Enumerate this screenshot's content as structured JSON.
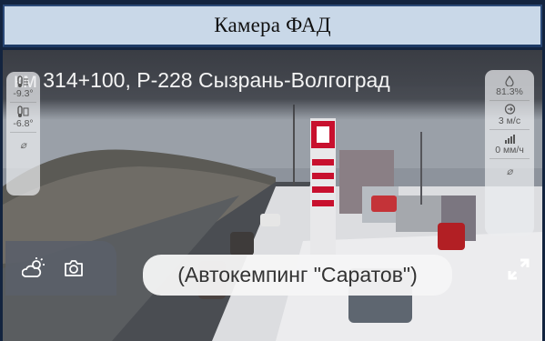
{
  "window": {
    "title": "Камера ФАД"
  },
  "camera": {
    "caption": "км 314+100, Р-228 Сызрань-Волгоград",
    "location": "(Автокемпинг \"Саратов\")"
  },
  "sensors_left": [
    {
      "icon": "road-temperature-icon",
      "value": "-9.3°"
    },
    {
      "icon": "air-temperature-icon",
      "value": "-6.8°"
    }
  ],
  "sensors_right": [
    {
      "icon": "humidity-icon",
      "value": "81.3%"
    },
    {
      "icon": "wind-icon",
      "value": "3 м/с"
    },
    {
      "icon": "precipitation-icon",
      "value": "0 мм/ч"
    }
  ],
  "controls": {
    "weather_icon": "weather-icon",
    "snapshot_icon": "camera-icon",
    "expand_icon": "expand-icon"
  },
  "colors": {
    "title_bg": "#c9d8e8",
    "frame": "#13243f",
    "caption_bg": "#3a3d44",
    "brand_red": "#c8102e"
  }
}
